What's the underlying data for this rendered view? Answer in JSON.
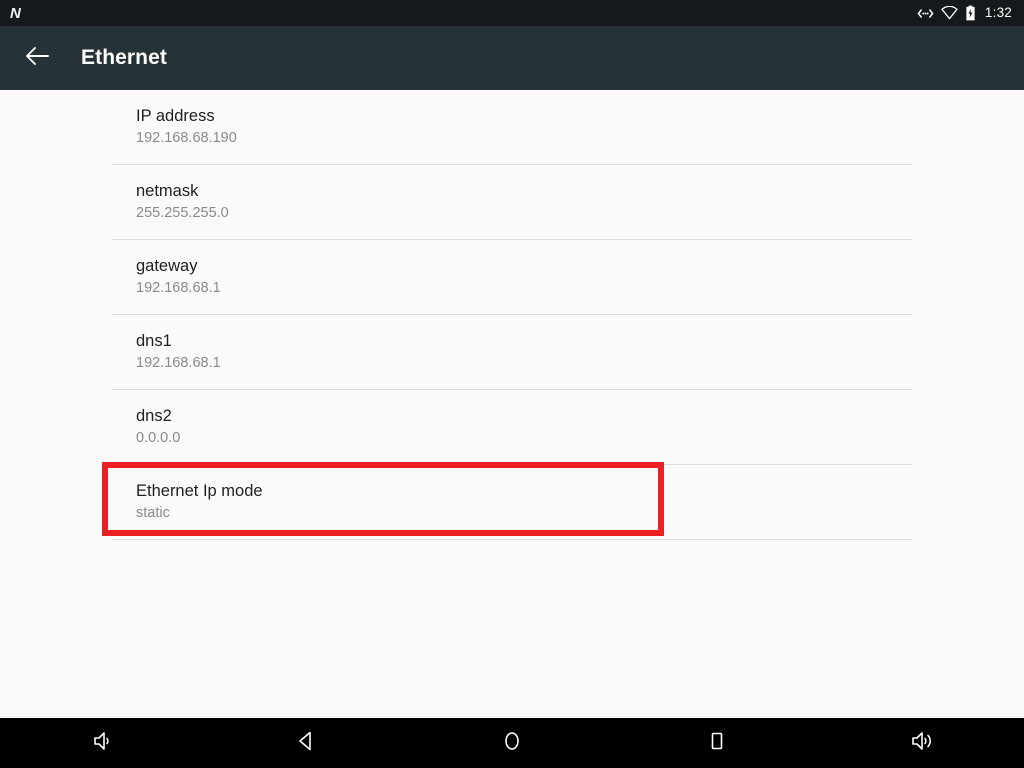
{
  "status_bar": {
    "logo": "N",
    "clock": "1:32",
    "icons": [
      {
        "name": "ethernet-icon",
        "glyph": "network"
      },
      {
        "name": "wifi-no-signal-icon",
        "glyph": "wifi"
      },
      {
        "name": "battery-charging-icon",
        "glyph": "battery"
      }
    ],
    "background_color": "#15191c"
  },
  "app_bar": {
    "title": "Ethernet",
    "back_label": "Navigate up",
    "background_color": "#273238"
  },
  "preferences": [
    {
      "title": "IP address",
      "summary": "192.168.68.190",
      "highlighted": false
    },
    {
      "title": "netmask",
      "summary": "255.255.255.0",
      "highlighted": false
    },
    {
      "title": "gateway",
      "summary": "192.168.68.1",
      "highlighted": false
    },
    {
      "title": "dns1",
      "summary": "192.168.68.1",
      "highlighted": false
    },
    {
      "title": "dns2",
      "summary": "0.0.0.0",
      "highlighted": false
    },
    {
      "title": "Ethernet Ip mode",
      "summary": "static",
      "highlighted": true
    }
  ],
  "highlight": {
    "color": "#ED2024",
    "target": "Ethernet Ip mode"
  },
  "nav_bar": {
    "buttons": [
      {
        "name": "volume-down-button",
        "label": "Volume down"
      },
      {
        "name": "back-button",
        "label": "Back"
      },
      {
        "name": "home-button",
        "label": "Home"
      },
      {
        "name": "recents-button",
        "label": "Recent apps"
      },
      {
        "name": "volume-up-button",
        "label": "Volume up"
      }
    ],
    "background_color": "#000000"
  }
}
